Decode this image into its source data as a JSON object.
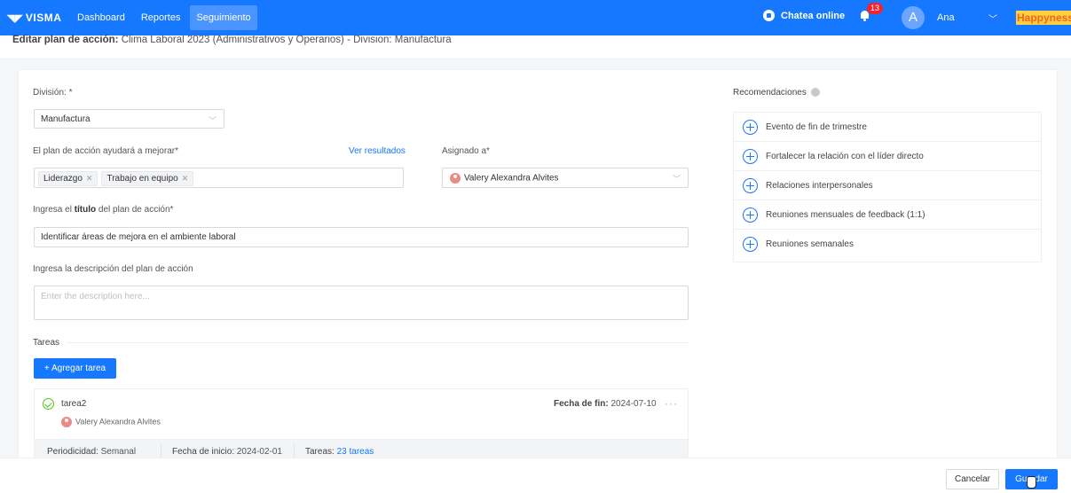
{
  "nav": {
    "brand": "VISMA",
    "items": [
      "Dashboard",
      "Reportes",
      "Seguimiento"
    ],
    "active": "Seguimiento",
    "chat_label": "Chatea online",
    "notifications_count": "13",
    "avatar_letter": "A",
    "user_name": "Ana",
    "happyness": "Happyness"
  },
  "header": {
    "prefix": "Editar plan de acción:",
    "title": " Clima Laboral 2023 (Administrativos y Operarios) - Division: Manufactura"
  },
  "form": {
    "division_label": "División: *",
    "division_value": "Manufactura",
    "improve_label": "El plan de acción ayudará a mejorar*",
    "results_link": "Ver resultados",
    "tags": [
      "Liderazgo",
      "Trabajo en equipo"
    ],
    "assigned_label": "Asignado a*",
    "assigned_value": "Valery Alexandra Alvites",
    "title_label_pre": "Ingresa el ",
    "title_label_bold": "título",
    "title_label_post": " del plan de acción*",
    "title_value": "Identificar áreas de mejora en el ambiente laboral",
    "description_label": "Ingresa la descripción del plan de acción",
    "description_placeholder": "Enter the description here..."
  },
  "tasks": {
    "section_label": "Tareas",
    "add_button": "+ Agregar tarea",
    "items": [
      {
        "name": "tarea2",
        "assignee": "Valery Alexandra Alvites",
        "end_label": "Fecha de fin:",
        "end_value": " 2024-07-10",
        "periodicity_label": "Periodicidad:",
        "periodicity_value": " Semanal",
        "start_label": "Fecha de inicio:",
        "start_value": " 2024-02-01",
        "count_label": "Tareas:",
        "count_value": "23 tareas"
      }
    ]
  },
  "recommendations": {
    "title": "Recomendaciones",
    "items": [
      "Evento de fin de trimestre",
      "Fortalecer la relación con el líder directo",
      "Relaciones interpersonales",
      "Reuniones mensuales de feedback (1:1)",
      "Reuniones semanales"
    ]
  },
  "footer": {
    "cancel": "Cancelar",
    "save": "Guardar"
  },
  "colors": {
    "primary": "#1677ff",
    "badge": "#f5222d",
    "success": "#52c41a"
  }
}
